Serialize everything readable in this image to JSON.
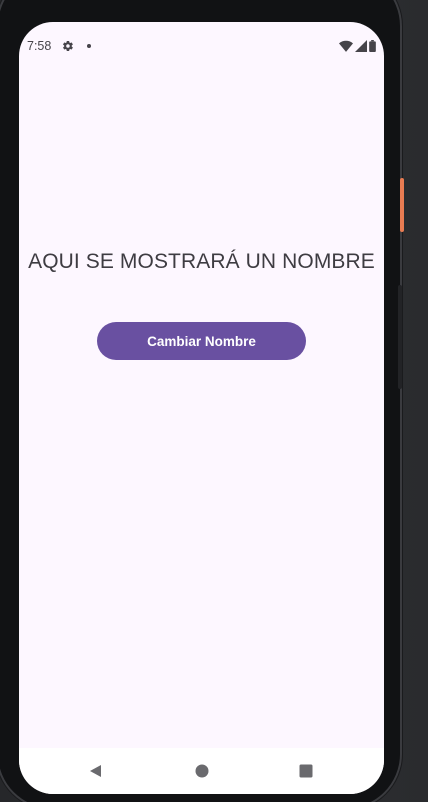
{
  "status_bar": {
    "time": "7:58",
    "icons": [
      "settings-gear-icon",
      "notification-dot-icon",
      "wifi-icon",
      "cellular-signal-icon",
      "battery-icon"
    ]
  },
  "main": {
    "title": "AQUI SE MOSTRARÁ UN NOMBRE",
    "button_label": "Cambiar Nombre"
  },
  "navigation": {
    "buttons": [
      "back-icon",
      "home-icon",
      "recents-icon"
    ]
  },
  "colors": {
    "screen_background": "#fdf7ff",
    "button_background": "#6950a1",
    "button_text": "#ffffff",
    "title_text": "#3e3c42",
    "power_button_accent": "#e87c52"
  }
}
